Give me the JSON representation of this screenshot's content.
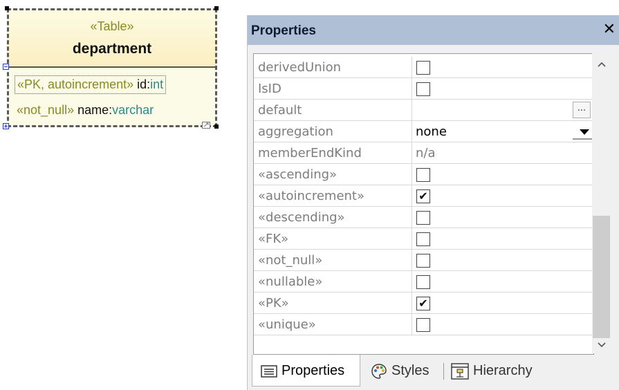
{
  "uml_table": {
    "stereotype": "«Table»",
    "name": "department",
    "attributes": [
      {
        "stereotype": "«PK, autoincrement»",
        "name": "id",
        "colon": ":",
        "type": "int"
      },
      {
        "stereotype": "«not_null»",
        "name": "name",
        "colon": ":",
        "type": "varchar"
      }
    ]
  },
  "properties_panel": {
    "title": "Properties",
    "close_glyph": "✕",
    "rows": [
      {
        "label": "derivedUnion",
        "kind": "checkbox",
        "checked": false
      },
      {
        "label": "IsID",
        "kind": "checkbox",
        "checked": false
      },
      {
        "label": "default",
        "kind": "text-ellipsis",
        "value": "",
        "button": "..."
      },
      {
        "label": "aggregation",
        "kind": "dropdown",
        "value": "none"
      },
      {
        "label": "memberEndKind",
        "kind": "readonly",
        "value": "n/a"
      },
      {
        "label": "«ascending»",
        "kind": "checkbox",
        "checked": false
      },
      {
        "label": "«autoincrement»",
        "kind": "checkbox",
        "checked": true
      },
      {
        "label": "«descending»",
        "kind": "checkbox",
        "checked": false
      },
      {
        "label": "«FK»",
        "kind": "checkbox",
        "checked": false
      },
      {
        "label": "«not_null»",
        "kind": "checkbox",
        "checked": false
      },
      {
        "label": "«nullable»",
        "kind": "checkbox",
        "checked": false
      },
      {
        "label": "«PK»",
        "kind": "checkbox",
        "checked": true
      },
      {
        "label": "«unique»",
        "kind": "checkbox",
        "checked": false
      }
    ],
    "check_glyph": "✔",
    "tabs": [
      {
        "label": "Properties",
        "icon": "properties-icon",
        "active": true
      },
      {
        "label": "Styles",
        "icon": "palette-icon",
        "active": false
      },
      {
        "label": "Hierarchy",
        "icon": "hierarchy-icon",
        "active": false
      }
    ]
  },
  "colors": {
    "titlebar": "#aebfd6",
    "stereotype_text": "#8c8a1e",
    "type_text": "#2a8a8a",
    "label_text": "#7d7d7d"
  }
}
